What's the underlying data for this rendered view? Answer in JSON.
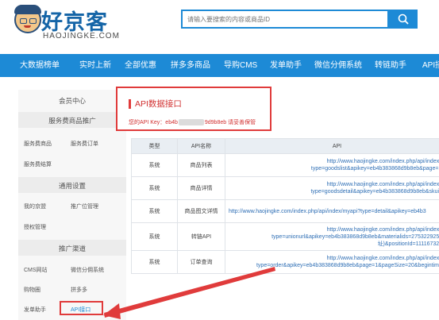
{
  "brand": {
    "name_cn": "好京客",
    "name_en": "HAOJINGKE.COM"
  },
  "search": {
    "placeholder": "请输入要搜索的内容或商品ID"
  },
  "nav": {
    "items": [
      "大数据榜单",
      "实时上新",
      "全部优惠",
      "拼多多商品",
      "导购CMS",
      "发单助手",
      "微信分佣系统",
      "转链助手",
      "API接口"
    ]
  },
  "sidebar": {
    "member_center": "会员中心",
    "service_promo": "服务费商品推广",
    "service_goods": "服务费商品",
    "service_orders": "服务费订单",
    "service_settle": "服务费结算",
    "general_settings": "通用设置",
    "my_jd": "我的京盟",
    "promo_position": "推广位管理",
    "auth_manage": "授权管理",
    "promo_channel": "推广渠道",
    "cms_site": "CMS网站",
    "wechat_commission": "微信分佣系统",
    "shopping_cart": "购物圈",
    "pinduoduo": "拼多多",
    "post_assistant": "发单助手",
    "api_interface": "API接口"
  },
  "main": {
    "title": "API数据接口",
    "apikey_label": "您的API Key：",
    "apikey_prefix": "eb4b",
    "apikey_suffix": "9d9b8eb",
    "apikey_note": "请妥善保管"
  },
  "table": {
    "headers": [
      "类型",
      "API名称",
      "API"
    ],
    "rows": [
      {
        "type": "系统",
        "name": "商品列表",
        "api_line1": "http://www.haojingke.com/index.php/api/index/m",
        "api_line2": "type=goodslist&apikey=eb4b383868d9b8eb&page=1&"
      },
      {
        "type": "系统",
        "name": "商品详情",
        "api_line1": "http://www.haojingke.com/index.php/api/index/m",
        "api_line2": "type=goodsdetail&apikey=eb4b383868d9b8eb&skuid="
      },
      {
        "type": "系统",
        "name": "商品图文详情",
        "api_line1": "http://www.haojingke.com/index.php/api/index/myapi?type=detail&apikey=eb4b3",
        "api_line2": ""
      },
      {
        "type": "系统",
        "name": "转链API",
        "api_line1": "http://www.haojingke.com/index.php/api/index/m",
        "api_line2": "type=unionurl&apikey=eb4b383868d9b8eb&materialids=27532292569",
        "api_line3": "址)&positionId=1111673209"
      },
      {
        "type": "系统",
        "name": "订单查询",
        "api_line1": "http://www.haojingke.com/index.php/api/index/m",
        "api_line2": "type=order&apikey=eb4b383868d9b8eb&page=1&pageSize=20&begintime="
      }
    ]
  },
  "colors": {
    "brand_blue": "#1d8ad6",
    "annotation_red": "#e03b3b",
    "link_blue": "#2f6fb5"
  }
}
